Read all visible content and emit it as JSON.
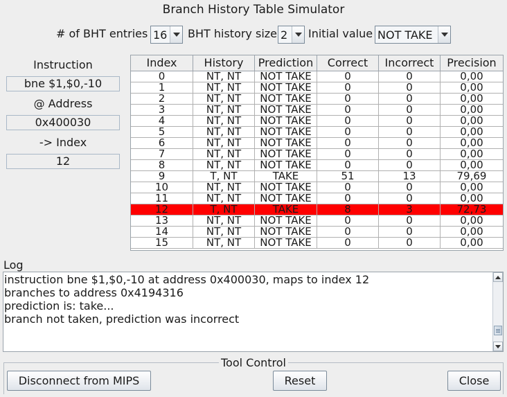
{
  "window": {
    "title": "Branch History Table Simulator"
  },
  "config": {
    "entries_label": "# of BHT entries",
    "entries_value": "16",
    "history_label": "BHT history size",
    "history_value": "2",
    "initial_label": "Initial value",
    "initial_value": "NOT TAKE"
  },
  "side": {
    "instruction_label": "Instruction",
    "instruction_value": "bne $1,$0,-10",
    "address_label": "@ Address",
    "address_value": "0x400030",
    "index_label": "-> Index",
    "index_value": "12"
  },
  "table": {
    "columns": [
      "Index",
      "History",
      "Prediction",
      "Correct",
      "Incorrect",
      "Precision"
    ],
    "highlight_row": 12,
    "highlight_color": "#ff0000",
    "rows": [
      [
        "0",
        "NT, NT",
        "NOT TAKE",
        "0",
        "0",
        "0,00"
      ],
      [
        "1",
        "NT, NT",
        "NOT TAKE",
        "0",
        "0",
        "0,00"
      ],
      [
        "2",
        "NT, NT",
        "NOT TAKE",
        "0",
        "0",
        "0,00"
      ],
      [
        "3",
        "NT, NT",
        "NOT TAKE",
        "0",
        "0",
        "0,00"
      ],
      [
        "4",
        "NT, NT",
        "NOT TAKE",
        "0",
        "0",
        "0,00"
      ],
      [
        "5",
        "NT, NT",
        "NOT TAKE",
        "0",
        "0",
        "0,00"
      ],
      [
        "6",
        "NT, NT",
        "NOT TAKE",
        "0",
        "0",
        "0,00"
      ],
      [
        "7",
        "NT, NT",
        "NOT TAKE",
        "0",
        "0",
        "0,00"
      ],
      [
        "8",
        "NT, NT",
        "NOT TAKE",
        "0",
        "0",
        "0,00"
      ],
      [
        "9",
        "T, NT",
        "TAKE",
        "51",
        "13",
        "79,69"
      ],
      [
        "10",
        "NT, NT",
        "NOT TAKE",
        "0",
        "0",
        "0,00"
      ],
      [
        "11",
        "NT, NT",
        "NOT TAKE",
        "0",
        "0",
        "0,00"
      ],
      [
        "12",
        "T, NT",
        "TAKE",
        "8",
        "3",
        "72,73"
      ],
      [
        "13",
        "NT, NT",
        "NOT TAKE",
        "0",
        "0",
        "0,00"
      ],
      [
        "14",
        "NT, NT",
        "NOT TAKE",
        "0",
        "0",
        "0,00"
      ],
      [
        "15",
        "NT, NT",
        "NOT TAKE",
        "0",
        "0",
        "0,00"
      ]
    ]
  },
  "log": {
    "label": "Log",
    "lines": [
      "instruction bne $1,$0,-10 at address 0x400030, maps to index 12",
      "branches to address 0x4194316",
      "prediction is: take...",
      "branch not taken, prediction was incorrect"
    ]
  },
  "tool_control": {
    "title": "Tool Control",
    "disconnect_label": "Disconnect from MIPS",
    "reset_label": "Reset",
    "close_label": "Close"
  },
  "icons": {
    "combo_arrow": "chevron-down-icon",
    "scroll_up": "arrow-up-icon",
    "scroll_down": "arrow-down-icon"
  }
}
